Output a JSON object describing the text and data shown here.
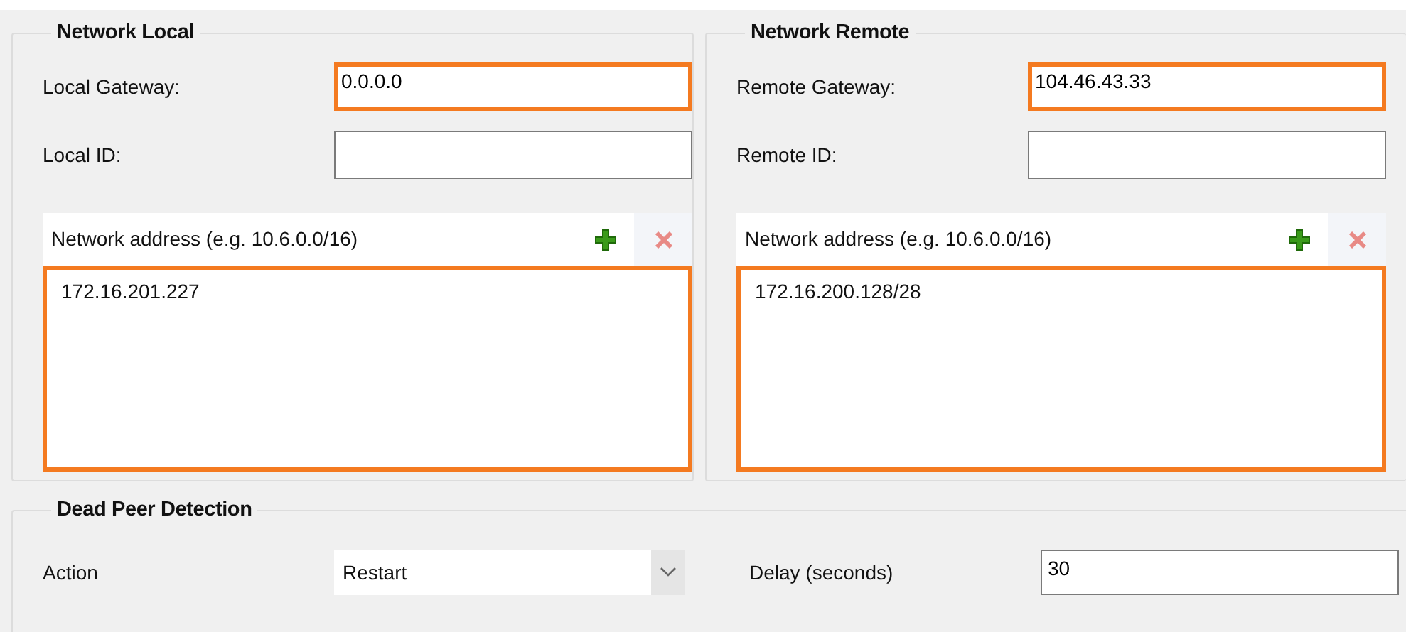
{
  "network_local": {
    "title": "Network Local",
    "gateway": {
      "label": "Local Gateway:",
      "value": "0.0.0.0",
      "highlighted": true
    },
    "id": {
      "label": "Local ID:",
      "highlighted": false
    },
    "address_list": {
      "header": "Network address (e.g. 10.6.0.0/16)",
      "add": {
        "disabled": false
      },
      "remove": {
        "disabled": true
      },
      "highlighted": true,
      "items": [
        {
          "text": "172.16.201.227"
        }
      ]
    }
  },
  "network_remote": {
    "title": "Network Remote",
    "gateway": {
      "label": "Remote Gateway:",
      "value": "104.46.43.33",
      "highlighted": true
    },
    "id": {
      "label": "Remote ID:",
      "highlighted": false
    },
    "address_list": {
      "header": "Network address (e.g. 10.6.0.0/16)",
      "add": {
        "disabled": false
      },
      "remove": {
        "disabled": true
      },
      "highlighted": true,
      "items": [
        {
          "text": "172.16.200.128/28"
        }
      ]
    }
  },
  "dead_peer_detection": {
    "title": "Dead Peer Detection",
    "action": {
      "label": "Action",
      "value": "Restart"
    },
    "delay": {
      "label": "Delay (seconds)",
      "value": "30"
    }
  }
}
